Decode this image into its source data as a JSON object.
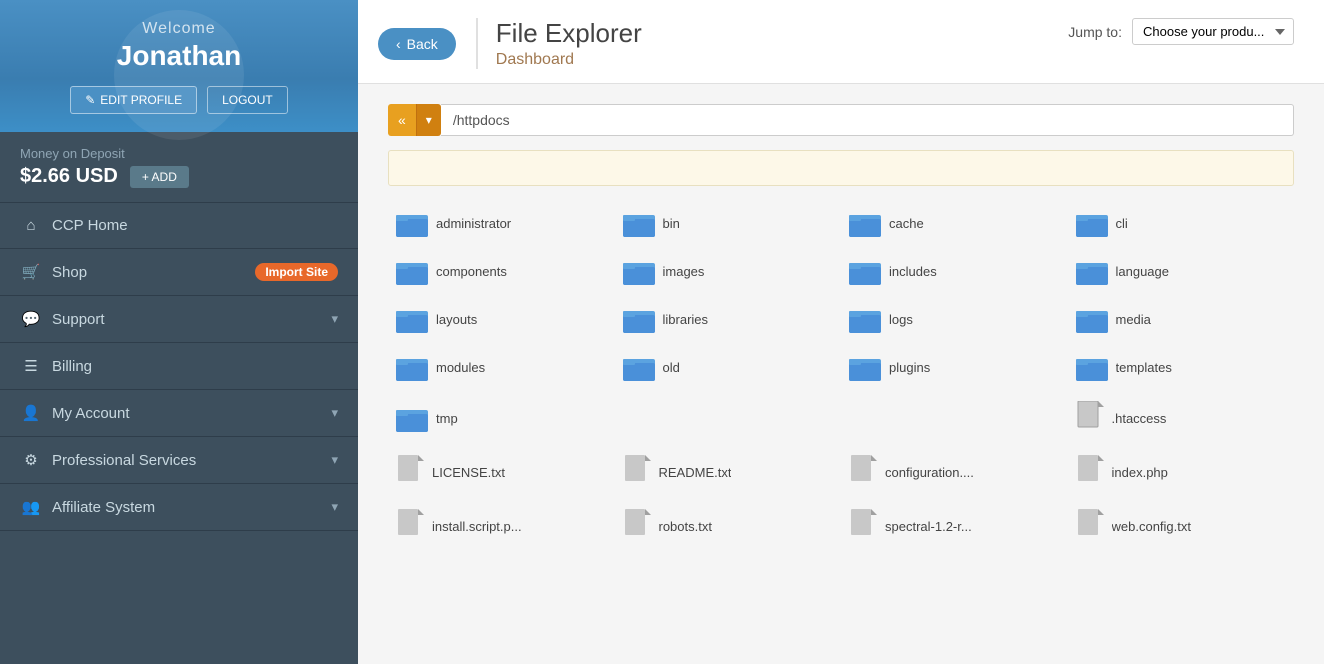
{
  "sidebar": {
    "welcome": "Welcome",
    "username": "Jonathan",
    "edit_profile_label": "EDIT PROFILE",
    "logout_label": "LOGOUT",
    "money_label": "Money on Deposit",
    "money_amount": "$2.66 USD",
    "add_label": "+ ADD",
    "nav_items": [
      {
        "id": "ccp-home",
        "icon": "home",
        "label": "CCP Home",
        "has_arrow": false,
        "badge": null
      },
      {
        "id": "shop",
        "icon": "cart",
        "label": "Shop",
        "has_arrow": false,
        "badge": "Import Site"
      },
      {
        "id": "support",
        "icon": "chat",
        "label": "Support",
        "has_arrow": true,
        "badge": null
      },
      {
        "id": "billing",
        "icon": "list",
        "label": "Billing",
        "has_arrow": false,
        "badge": null
      },
      {
        "id": "my-account",
        "icon": "user",
        "label": "My Account",
        "has_arrow": true,
        "badge": null
      },
      {
        "id": "professional-services",
        "icon": "gear",
        "label": "Professional Services",
        "has_arrow": true,
        "badge": null
      },
      {
        "id": "affiliate-system",
        "icon": "users",
        "label": "Affiliate System",
        "has_arrow": true,
        "badge": null
      }
    ]
  },
  "header": {
    "back_label": "Back",
    "title": "File Explorer",
    "subtitle": "Dashboard",
    "jump_label": "Jump to:",
    "jump_placeholder": "Choose your produ...",
    "jump_options": [
      "Choose your produ..."
    ]
  },
  "explorer": {
    "path": "/httpdocs",
    "folders": [
      "administrator",
      "bin",
      "cache",
      "cli",
      "components",
      "images",
      "includes",
      "language",
      "layouts",
      "libraries",
      "logs",
      "media",
      "modules",
      "old",
      "plugins",
      "templates",
      "tmp"
    ],
    "files": [
      ".htaccess",
      "LICENSE.txt",
      "README.txt",
      "configuration....",
      "index.php",
      "install.script.p...",
      "robots.txt",
      "spectral-1.2-r...",
      "web.config.txt"
    ]
  }
}
